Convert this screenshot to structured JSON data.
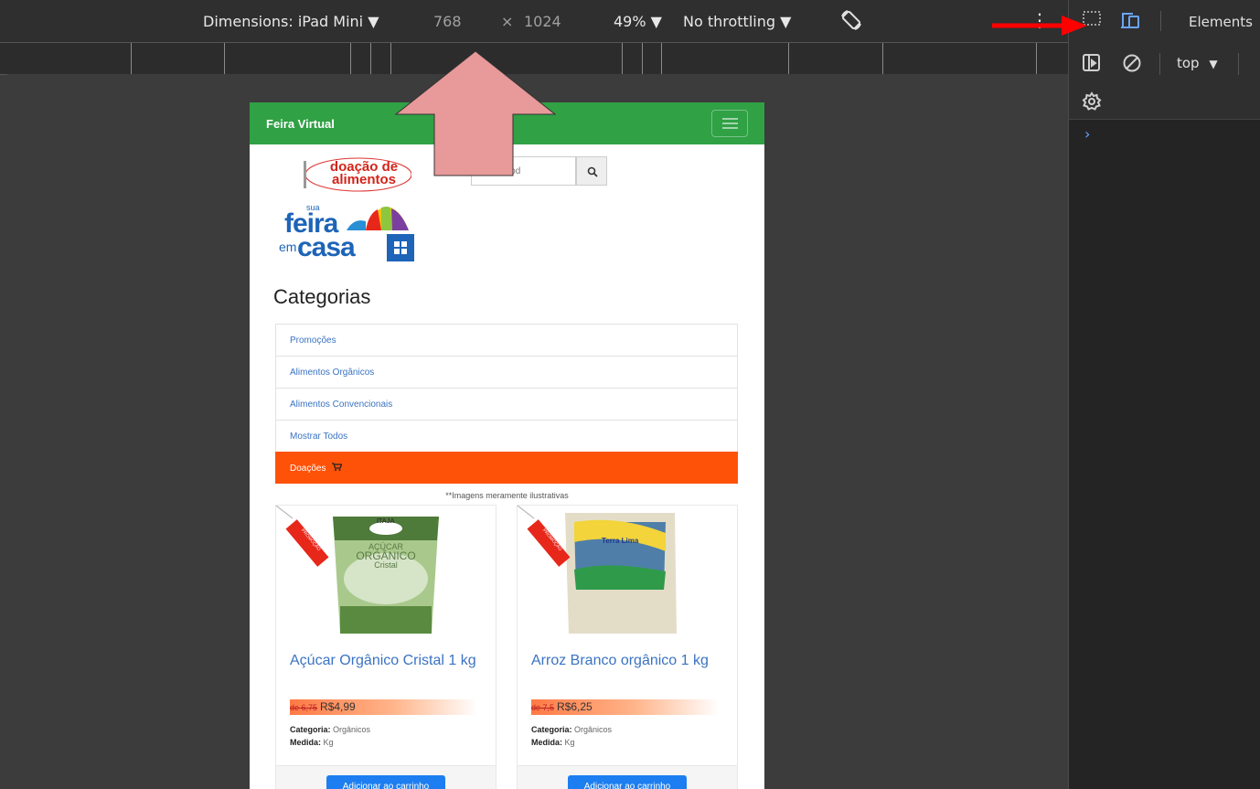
{
  "toolbar": {
    "dimensions_label": "Dimensions: iPad Mini",
    "width": "768",
    "times": "×",
    "height": "1024",
    "zoom": "49%",
    "throttling": "No throttling"
  },
  "devtools": {
    "elements_tab": "Elements",
    "context": "top",
    "console_prompt": "›"
  },
  "page": {
    "brand": "Feira Virtual",
    "logo1_line1": "doação de",
    "logo1_line2": "alimentos",
    "logo2_sua": "sua",
    "logo2_feira": "feira",
    "logo2_em": "em",
    "logo2_casa": "casa",
    "search_value": "e seu prod",
    "categories_title": "Categorias",
    "categories": [
      {
        "label": "Promoções"
      },
      {
        "label": "Alimentos Orgânicos"
      },
      {
        "label": "Alimentos Convencionais"
      },
      {
        "label": "Mostrar Todos"
      },
      {
        "label": "Doações"
      }
    ],
    "disclaimer": "**Imagens meramente ilustrativas",
    "products": [
      {
        "title": "Açúcar Orgânico Cristal 1 kg",
        "old_price": "de 6,75",
        "price": "R$4,99",
        "category_label": "Categoria:",
        "category": "Orgânicos",
        "measure_label": "Medida:",
        "measure": "Kg",
        "button": "Adicionar ao carrinho",
        "pkg_brand": "ITAJA",
        "pkg_line1": "AÇÚCAR",
        "pkg_line2": "ORGÂNICO",
        "pkg_line3": "Cristal",
        "tag": "PROMOÇÃO"
      },
      {
        "title": "Arroz Branco orgânico 1 kg",
        "old_price": "de 7,5",
        "price": "R$6,25",
        "category_label": "Categoria:",
        "category": "Orgânicos",
        "measure_label": "Medida:",
        "measure": "Kg",
        "button": "Adicionar ao carrinho",
        "pkg_brand": "Terra Lima",
        "tag": "PROMOÇÃO"
      }
    ]
  },
  "colors": {
    "navbar": "#30a145",
    "active_category": "#ff5209",
    "link": "#3a73c2",
    "button": "#1c7ef0",
    "annotation_arrow": "#e89999",
    "red_arrow": "#ff0000"
  }
}
